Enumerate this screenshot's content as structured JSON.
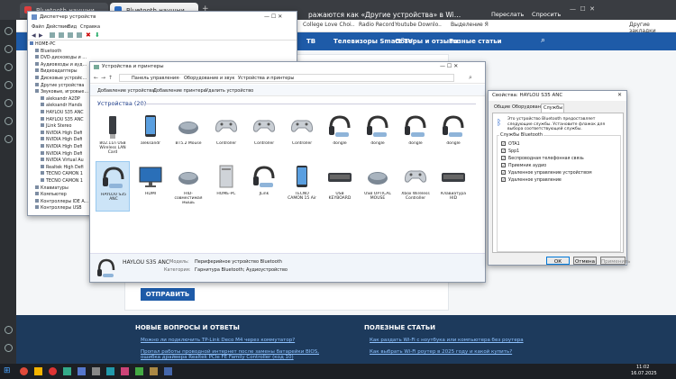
{
  "browser": {
    "tabs": [
      {
        "label": "Bluetooth наушники в..."
      },
      {
        "label": "Bluetooth наушники ..."
      }
    ],
    "page_headline": "ражаются как «Другие устройства» в Windows 11, 10",
    "top_actions": [
      "Переслать",
      "Спросить"
    ],
    "bookmarks": [
      "College Love Choi..",
      "Radio Record",
      "Youtube Downlo..",
      "Выделение Я"
    ],
    "bookmarks_right": "Другие закладки",
    "nav_links": [
      "ТВ",
      "Телевизоры Smart TV",
      "Обзоры и отзывы",
      "Разные статьи"
    ],
    "submit_button": "ОТПРАВИТЬ",
    "footer": {
      "left_title": "НОВЫЕ ВОПРОСЫ И ОТВЕТЫ",
      "left_items": [
        "Можно ли подключить TP-Link Deco M4 через коммутатор?",
        "Пропал работы проводной интернет после замены батарейки BIOS, ошибка драйвера Realtek PCIe FE Family Controller (код 10)"
      ],
      "right_title": "ПОЛЕЗНЫЕ СТАТЬИ",
      "right_items": [
        "Как раздать Wi-Fi с ноутбука или компьютера без роутера",
        "Как выбрать Wi-Fi роутер в 2025 году и какой купить?"
      ]
    }
  },
  "device_manager": {
    "title": "Диспетчер устройств",
    "menu": [
      "Файл",
      "Действие",
      "Вид",
      "Справка"
    ],
    "tree": [
      "HOME-PC",
      "Bluetooth",
      "DVD-дисководы и дисководы",
      "Аудиовходы и аудиовыходы",
      "Видеоадаптеры",
      "Дисковые устройства",
      "Другие устройства",
      "Звуковые, игровые и видео",
      "aleksandr A2DP",
      "aleksandr Hands",
      "HAYLOU S35 ANC",
      "HAYLOU S35 ANC",
      "JLink Stereo",
      "NVIDIA High Defi",
      "NVIDIA High Defi",
      "NVIDIA High Defi",
      "NVIDIA High Defi",
      "NVIDIA Virtual Au",
      "Realtek High Defi",
      "TECNO CAMON 1",
      "TECNO CAMON 1",
      "Клавиатуры",
      "Компьютер",
      "Контроллеры IDE ATA/ATAPI",
      "Контроллеры USB"
    ]
  },
  "devices_window": {
    "title": "Устройства и принтеры",
    "breadcrumb": [
      "Панель управления",
      "Оборудование и звук",
      "Устройства и принтеры"
    ],
    "toolbar": [
      "Добавление устройства",
      "Добавление принтера",
      "Удалить устройство"
    ],
    "section": "Устройства (20)",
    "row1": [
      {
        "label": "802.11n USB Wireless LAN Card",
        "icon": "usb-adapter-icon"
      },
      {
        "label": "aleksandr",
        "icon": "phone-icon"
      },
      {
        "label": "BT5.2 Mouse",
        "icon": "mouse-icon"
      },
      {
        "label": "Controller",
        "icon": "gamepad-icon"
      },
      {
        "label": "Controller",
        "icon": "gamepad-icon"
      },
      {
        "label": "Controller",
        "icon": "gamepad-icon"
      },
      {
        "label": "dongle",
        "icon": "headset-icon"
      },
      {
        "label": "dongle",
        "icon": "headset-icon"
      },
      {
        "label": "dongle",
        "icon": "headset-icon"
      },
      {
        "label": "dongle",
        "icon": "headset-icon"
      }
    ],
    "row2": [
      {
        "label": "HAYLOU S35 ANC",
        "icon": "headset-icon"
      },
      {
        "label": "HDMI",
        "icon": "monitor-icon"
      },
      {
        "label": "HID-совместимая мышь",
        "icon": "mouse-icon"
      },
      {
        "label": "HOME-PC",
        "icon": "computer-icon"
      },
      {
        "label": "JLink",
        "icon": "headset-icon"
      },
      {
        "label": "TECNO CAMON 15 Air",
        "icon": "phone-icon"
      },
      {
        "label": "USB KEYBOARD",
        "icon": "keyboard-icon"
      },
      {
        "label": "USB OPTICAL MOUSE",
        "icon": "mouse-icon"
      },
      {
        "label": "Xbox Wireless Controller",
        "icon": "gamepad-icon"
      },
      {
        "label": "Клавиатура HID",
        "icon": "keyboard-icon"
      }
    ],
    "details": {
      "name": "HAYLOU S35 ANC",
      "model_label": "Модель:",
      "model_value": "Периферийное устройство Bluetooth",
      "category_label": "Категория:",
      "category_value": "Гарнитура Bluetooth; Аудиоустройство"
    }
  },
  "properties": {
    "title": "Свойства: HAYLOU S35 ANC",
    "tabs": [
      "Общие",
      "Оборудование",
      "Службы"
    ],
    "active_tab": "Службы",
    "description": "Это устройство Bluetooth предоставляет следующие службы. Установите флажок для выбора соответствующей службы.",
    "group_label": "Службы Bluetooth",
    "services": [
      "OTA1",
      "Spp1",
      "Беспроводная телефонная связь",
      "Приемник аудио",
      "Удаленное управление устройством",
      "Удаленное управление"
    ],
    "buttons": [
      "ОК",
      "Отмена",
      "Применить"
    ]
  },
  "taskbar": {
    "time": "11:02",
    "date": "16.07.2025"
  }
}
